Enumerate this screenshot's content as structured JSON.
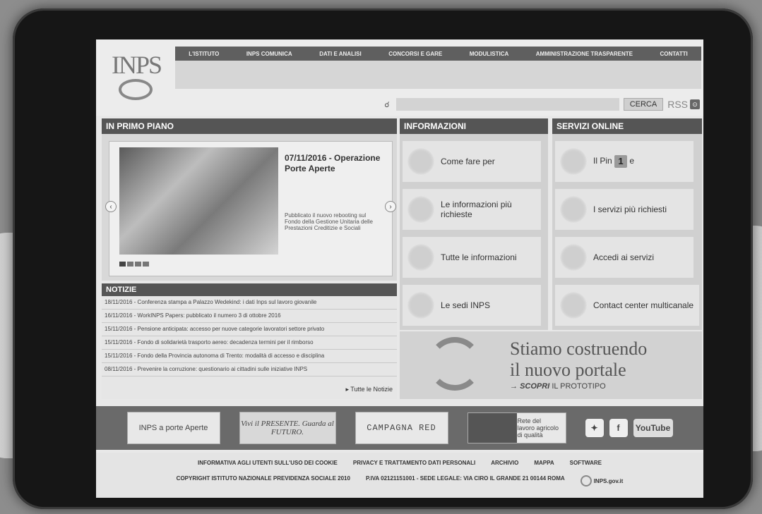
{
  "header": {
    "logo": "INPS",
    "nav": [
      "L'ISTITUTO",
      "INPS COMUNICA",
      "DATI E ANALISI",
      "CONCORSI E GARE",
      "MODULISTICA",
      "AMMINISTRAZIONE TRASPARENTE",
      "CONTATTI"
    ],
    "search_button": "CERCA",
    "rss": "RSS"
  },
  "primo_piano": {
    "heading": "IN PRIMO PIANO",
    "slide_title": "07/11/2016 - Operazione Porte Aperte",
    "slide_desc": "Pubblicato il nuovo rebooting sul Fondo della Gestione Unitaria delle Prestazioni Creditizie e Sociali"
  },
  "notizie": {
    "heading": "NOTIZIE",
    "items": [
      "18/11/2016 - Conferenza stampa a Palazzo Wedekind: i dati Inps sul lavoro giovanile",
      "16/11/2016 - WorkINPS Papers: pubblicato il numero 3 di ottobre 2016",
      "15/11/2016 - Pensione anticipata: accesso per nuove categorie lavoratori settore privato",
      "15/11/2016 - Fondo di solidarietà trasporto aereo: decadenza termini per il rimborso",
      "15/11/2016 - Fondo della Provincia autonoma di Trento: modalità di accesso e disciplina",
      "08/11/2016 - Prevenire la corruzione: questionario ai cittadini sulle iniziative INPS"
    ],
    "more": "Tutte le Notizie"
  },
  "informazioni": {
    "heading": "INFORMAZIONI",
    "cards": [
      "Come fare per",
      "Le informazioni più richieste",
      "Tutte le informazioni",
      "Le sedi INPS"
    ]
  },
  "servizi": {
    "heading": "SERVIZI ONLINE",
    "cards": [
      "Il Pin",
      "I servizi più richiesti",
      "Accedi ai servizi",
      "Contact center multicanale"
    ],
    "pin_suffix": "e",
    "badge": "1"
  },
  "portale": {
    "line1": "Stiamo costruendo",
    "line2": "il nuovo portale",
    "cta_bold": "SCOPRI",
    "cta_rest": "IL PROTOTIPO"
  },
  "banners": {
    "porte_aperte": "INPS a porte Aperte",
    "presente": "Vivi il PRESENTE. Guarda al FUTURO.",
    "campagna": "CAMPAGNA RED",
    "rete": "Rete del lavoro agricolo di qualità",
    "youtube": "YouTube"
  },
  "footer": {
    "row1": [
      "INFORMATIVA AGLI UTENTI SULL'USO DEI COOKIE",
      "PRIVACY E TRATTAMENTO DATI PERSONALI",
      "ARCHIVIO",
      "MAPPA",
      "SOFTWARE"
    ],
    "row2": [
      "COPYRIGHT ISTITUTO NAZIONALE PREVIDENZA SOCIALE 2010",
      "P.IVA 02121151001 - SEDE LEGALE: VIA CIRO IL GRANDE 21 00144 ROMA"
    ],
    "gov": "INPS.gov.it"
  }
}
